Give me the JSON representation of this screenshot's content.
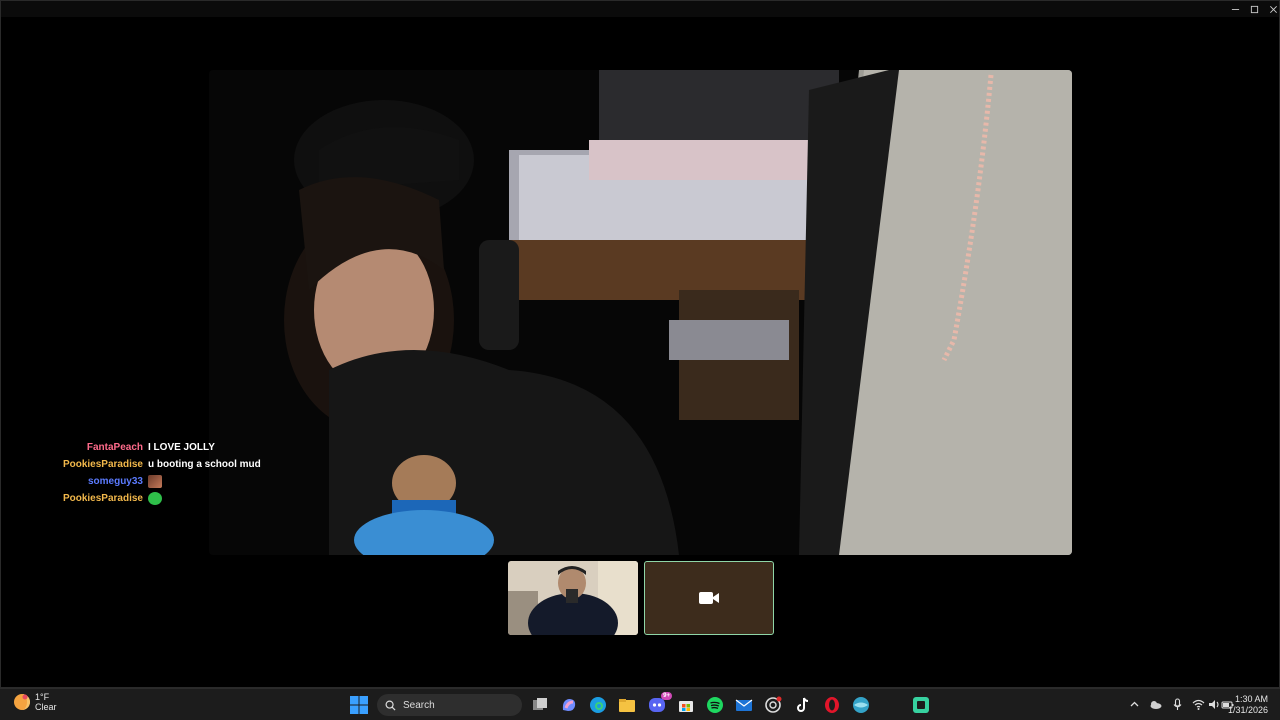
{
  "window": {
    "controls": [
      "minimize-icon",
      "maximize-icon",
      "close-icon"
    ]
  },
  "chat": [
    {
      "user": "FantaPeach",
      "color": "#ff6b8b",
      "message": "I LOVE JOLLY"
    },
    {
      "user": "PookiesParadise",
      "color": "#f2b84b",
      "message": "u booting a school mud"
    },
    {
      "user": "someguy33",
      "color": "#5b7bff",
      "message": "",
      "emote": "face-emote"
    },
    {
      "user": "PookiesParadise",
      "color": "#f2b84b",
      "message": "",
      "emote": "green-emote"
    }
  ],
  "thumbnails": [
    {
      "kind": "video"
    },
    {
      "kind": "camera-off",
      "icon": "video-camera-icon"
    }
  ],
  "taskbar": {
    "weather": {
      "temp": "1°F",
      "condition": "Clear",
      "icon": "weather-icon"
    },
    "search_placeholder": "Search",
    "apps": [
      "task-view-icon",
      "copilot-icon",
      "edge-icon",
      "file-explorer-icon",
      "discord-icon",
      "store-icon",
      "spotify-icon",
      "mail-icon",
      "chatgpt-icon",
      "tiktok-icon",
      "opera-icon",
      "browser-icon",
      "obs-icon"
    ],
    "discord_badge": "9+",
    "tray": [
      "chevron-up-icon",
      "onedrive-icon",
      "microphone-icon",
      "wifi-icon",
      "volume-icon",
      "battery-icon"
    ],
    "time": "1:30 AM",
    "date": "1/31/2026"
  },
  "colors": {
    "accent": "#8fd6a7",
    "taskbar": "#1c1c1c"
  }
}
